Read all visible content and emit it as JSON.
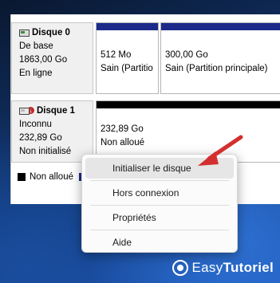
{
  "disks": [
    {
      "name": "Disque 0",
      "type": "De base",
      "size": "1863,00 Go",
      "status": "En ligne",
      "partitions": [
        {
          "size": "512 Mo",
          "status": "Sain (Partitio",
          "bar_color": "#1c2a8a"
        },
        {
          "size": "300,00 Go",
          "status": "Sain (Partition principale)",
          "bar_color": "#1c2a8a"
        }
      ]
    },
    {
      "name": "Disque 1",
      "type": "Inconnu",
      "size": "232,89 Go",
      "status": "Non initialisé",
      "partitions": [
        {
          "size": "232,89 Go",
          "status": "Non alloué",
          "bar_color": "#000000"
        }
      ]
    }
  ],
  "legend": {
    "unallocated": "Non alloué"
  },
  "context_menu": {
    "items": [
      {
        "label": "Initialiser le disque"
      },
      {
        "label": "Hors connexion"
      },
      {
        "label": "Propriétés"
      },
      {
        "label": "Aide"
      }
    ]
  },
  "brand": {
    "part1": "Easy",
    "part2": "Tutoriel"
  },
  "colors": {
    "arrow": "#d32f2f",
    "partition_bar": "#1c2a8a",
    "unallocated_bar": "#000000"
  }
}
